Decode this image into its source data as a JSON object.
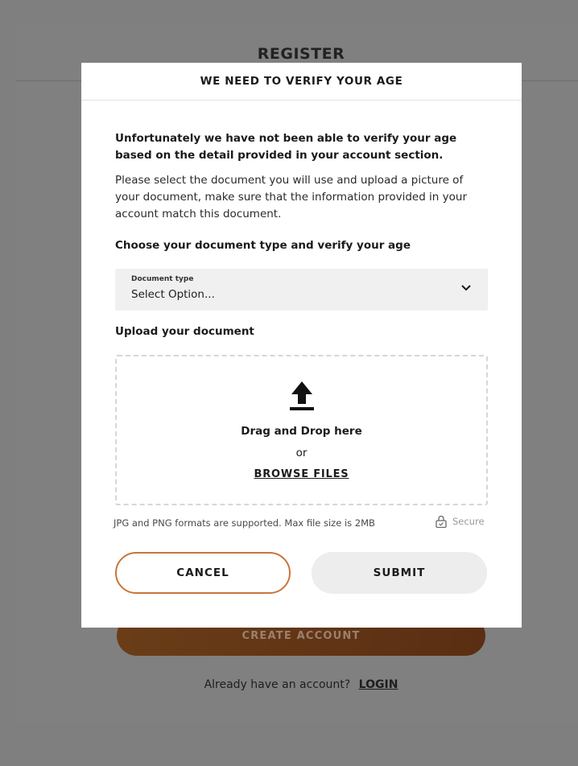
{
  "register_page": {
    "title": "REGISTER",
    "create_account_label": "CREATE ACCOUNT",
    "login_prompt": "Already have an account?",
    "login_link": "LOGIN"
  },
  "modal": {
    "title": "WE NEED TO VERIFY YOUR AGE",
    "lead": "Unfortunately we have not been able to verify your age based on the detail provided in your account section.",
    "description": "Please select the document you will use and upload a picture of your document, make sure that the information provided in your account match this document.",
    "doc_section_label": "Choose your document type and verify your age",
    "document_type": {
      "caption": "Document type",
      "value": "Select Option..."
    },
    "upload_section_label": "Upload your document",
    "dropzone": {
      "main": "Drag and Drop here",
      "or": "or",
      "browse": "BROWSE FILES"
    },
    "hint": "JPG and PNG formats are supported. Max file size is 2MB",
    "secure_label": "Secure",
    "cancel_label": "CANCEL",
    "submit_label": "SUBMIT"
  },
  "colors": {
    "overlay": "#7f7f7f",
    "accent": "#c8763c",
    "create_button": "#6a3d18"
  },
  "icons": {
    "chevron": "chevron-down-icon",
    "upload": "upload-icon",
    "lock": "lock-icon"
  }
}
